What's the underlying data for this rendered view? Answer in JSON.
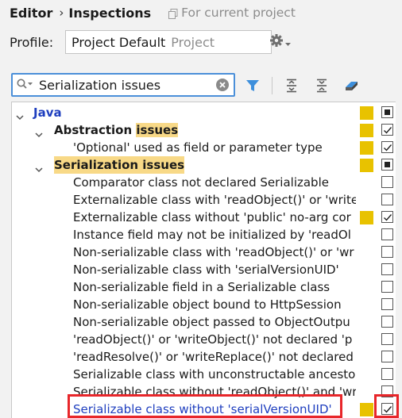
{
  "breadcrumb": {
    "editor": "Editor",
    "separator": "›",
    "inspections": "Inspections",
    "scope": "For current project"
  },
  "profile": {
    "label": "Profile:",
    "name": "Project Default",
    "type": "Project"
  },
  "search": {
    "value": "Serialization issues"
  },
  "tree": {
    "java": {
      "label": "Java",
      "checkbox": "mixed"
    },
    "abstraction": {
      "label_before": "Abstraction ",
      "label_highlight": "issues",
      "checkbox": "checked"
    },
    "optional": {
      "label": "'Optional' used as field or parameter type",
      "checkbox": "checked"
    },
    "serialization": {
      "label_highlight": "Serialization issues",
      "checkbox": "mixed"
    },
    "items": [
      {
        "label": "Comparator class not declared Serializable",
        "checked": false,
        "severity": false
      },
      {
        "label": "Externalizable class with 'readObject()' or 'write",
        "checked": false,
        "severity": false
      },
      {
        "label": "Externalizable class without 'public' no-arg cor",
        "checked": true,
        "severity": true
      },
      {
        "label": "Instance field may not be initialized by 'readOl",
        "checked": false,
        "severity": false
      },
      {
        "label": "Non-serializable class with 'readObject()' or 'wr",
        "checked": false,
        "severity": false
      },
      {
        "label": "Non-serializable class with 'serialVersionUID'",
        "checked": false,
        "severity": false
      },
      {
        "label": "Non-serializable field in a Serializable class",
        "checked": false,
        "severity": false
      },
      {
        "label": "Non-serializable object bound to HttpSession",
        "checked": false,
        "severity": false
      },
      {
        "label": "Non-serializable object passed to ObjectOutpu",
        "checked": false,
        "severity": false
      },
      {
        "label": "'readObject()' or 'writeObject()' not declared 'p",
        "checked": false,
        "severity": false
      },
      {
        "label": "'readResolve()' or 'writeReplace()' not declared",
        "checked": false,
        "severity": false
      },
      {
        "label": "Serializable class with unconstructable ancesto",
        "checked": false,
        "severity": false
      },
      {
        "label": "Serializable class without 'readObject()' and 'wri",
        "checked": false,
        "severity": false
      },
      {
        "label": "Serializable class without 'serialVersionUID'",
        "checked": true,
        "severity": true
      }
    ]
  },
  "colors": {
    "accent": "#4b8fd9",
    "severity_weak_warning": "#e8c200",
    "highlight": "#f8d987",
    "link_blue": "#1f3fbf",
    "annotation_red": "#e8262a"
  },
  "icons": [
    "copy-icon",
    "gear-icon",
    "chevron-down-icon",
    "search-icon",
    "clear-icon",
    "filter-icon",
    "expand-all-icon",
    "collapse-all-icon",
    "eraser-icon"
  ]
}
